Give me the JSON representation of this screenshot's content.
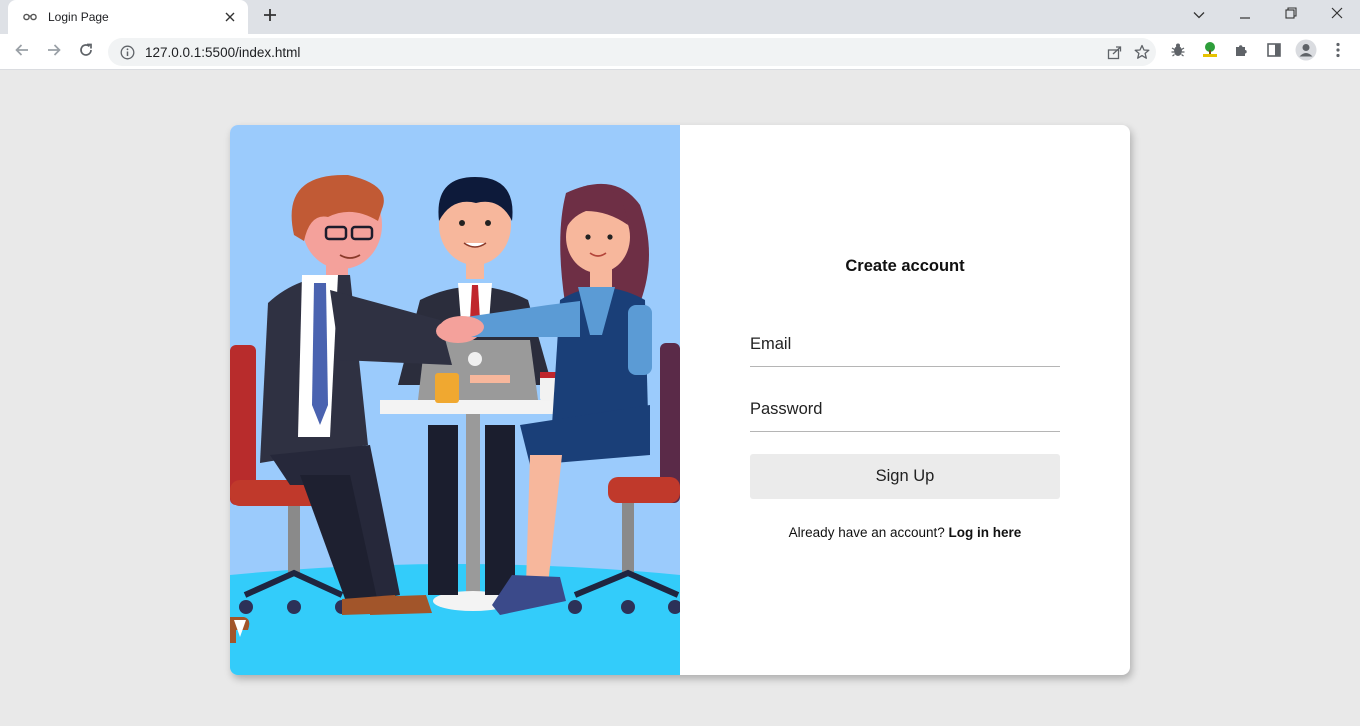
{
  "browser": {
    "tab_title": "Login Page",
    "url": "127.0.0.1:5500/index.html"
  },
  "icons": {
    "tab_favicon": "glasses-icon",
    "tab_close": "close-icon",
    "new_tab": "plus-icon",
    "tab_search": "chevron-down-icon",
    "minimize": "minimize-icon",
    "restore": "restore-icon",
    "close_window": "close-icon",
    "back": "arrow-left-icon",
    "forward": "arrow-right-icon",
    "reload": "reload-icon",
    "site_info": "info-icon",
    "share": "share-icon",
    "bookmark": "star-icon",
    "extension_bug": "bug-icon",
    "extension_tree": "tree-icon",
    "extensions": "puzzle-icon",
    "side_panel": "side-panel-icon",
    "profile": "profile-icon",
    "menu": "kebab-menu-icon"
  },
  "colors": {
    "page_background": "#e9e9e9",
    "illustration_sky": "#9bcbfc",
    "illustration_floor": "#33ccfa",
    "button_background": "#ebebeb"
  },
  "form": {
    "title": "Create account",
    "email_placeholder": "Email",
    "password_placeholder": "Password",
    "submit_label": "Sign Up",
    "login_prompt": "Already have an account?",
    "login_link": "Log in here"
  }
}
